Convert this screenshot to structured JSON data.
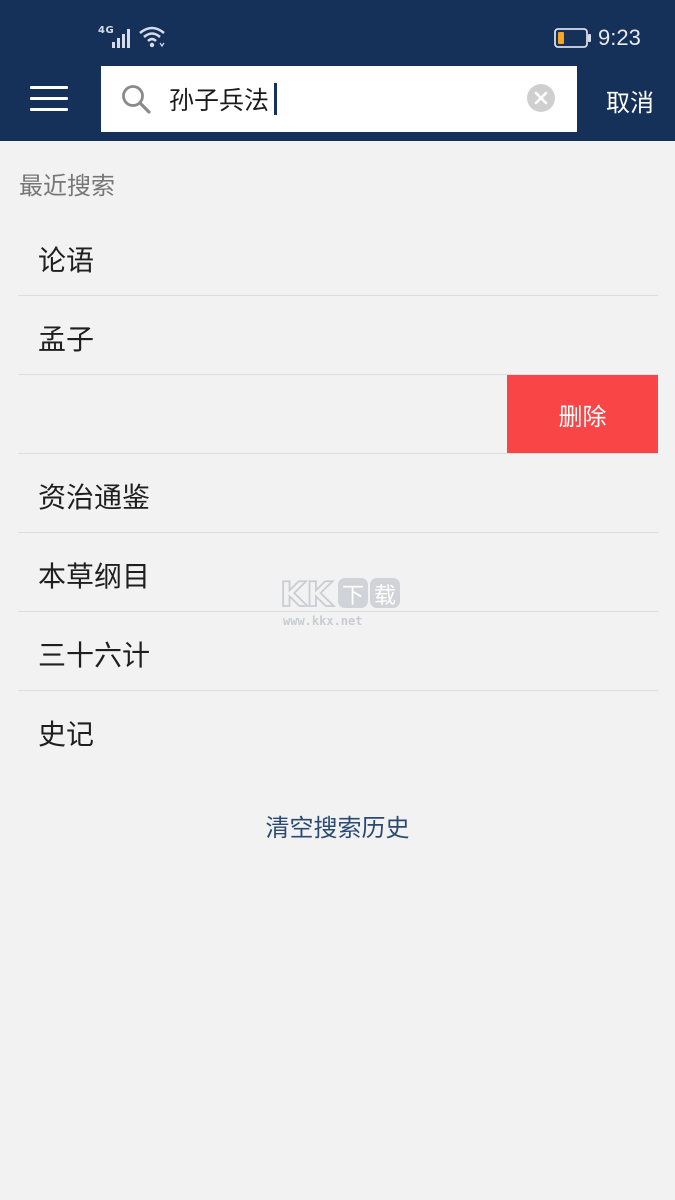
{
  "status_bar": {
    "network_label": "4G",
    "time": "9:23",
    "icons": [
      "signal-icon",
      "wifi-icon",
      "battery-icon"
    ]
  },
  "search": {
    "query": "孙子兵法",
    "cancel_label": "取消"
  },
  "history": {
    "section_title": "最近搜索",
    "items": [
      "论语",
      "孟子",
      "",
      "资治通鉴",
      "本草纲目",
      "三十六计",
      "史记"
    ],
    "delete_label": "删除",
    "clear_label": "清空搜索历史"
  },
  "watermark": {
    "logo_text": "KK下载",
    "url": "www.kkx.net"
  },
  "colors": {
    "header_bg": "#163159",
    "page_bg": "#f2f2f2",
    "delete_bg": "#fa4546",
    "link": "#2b4a73"
  }
}
